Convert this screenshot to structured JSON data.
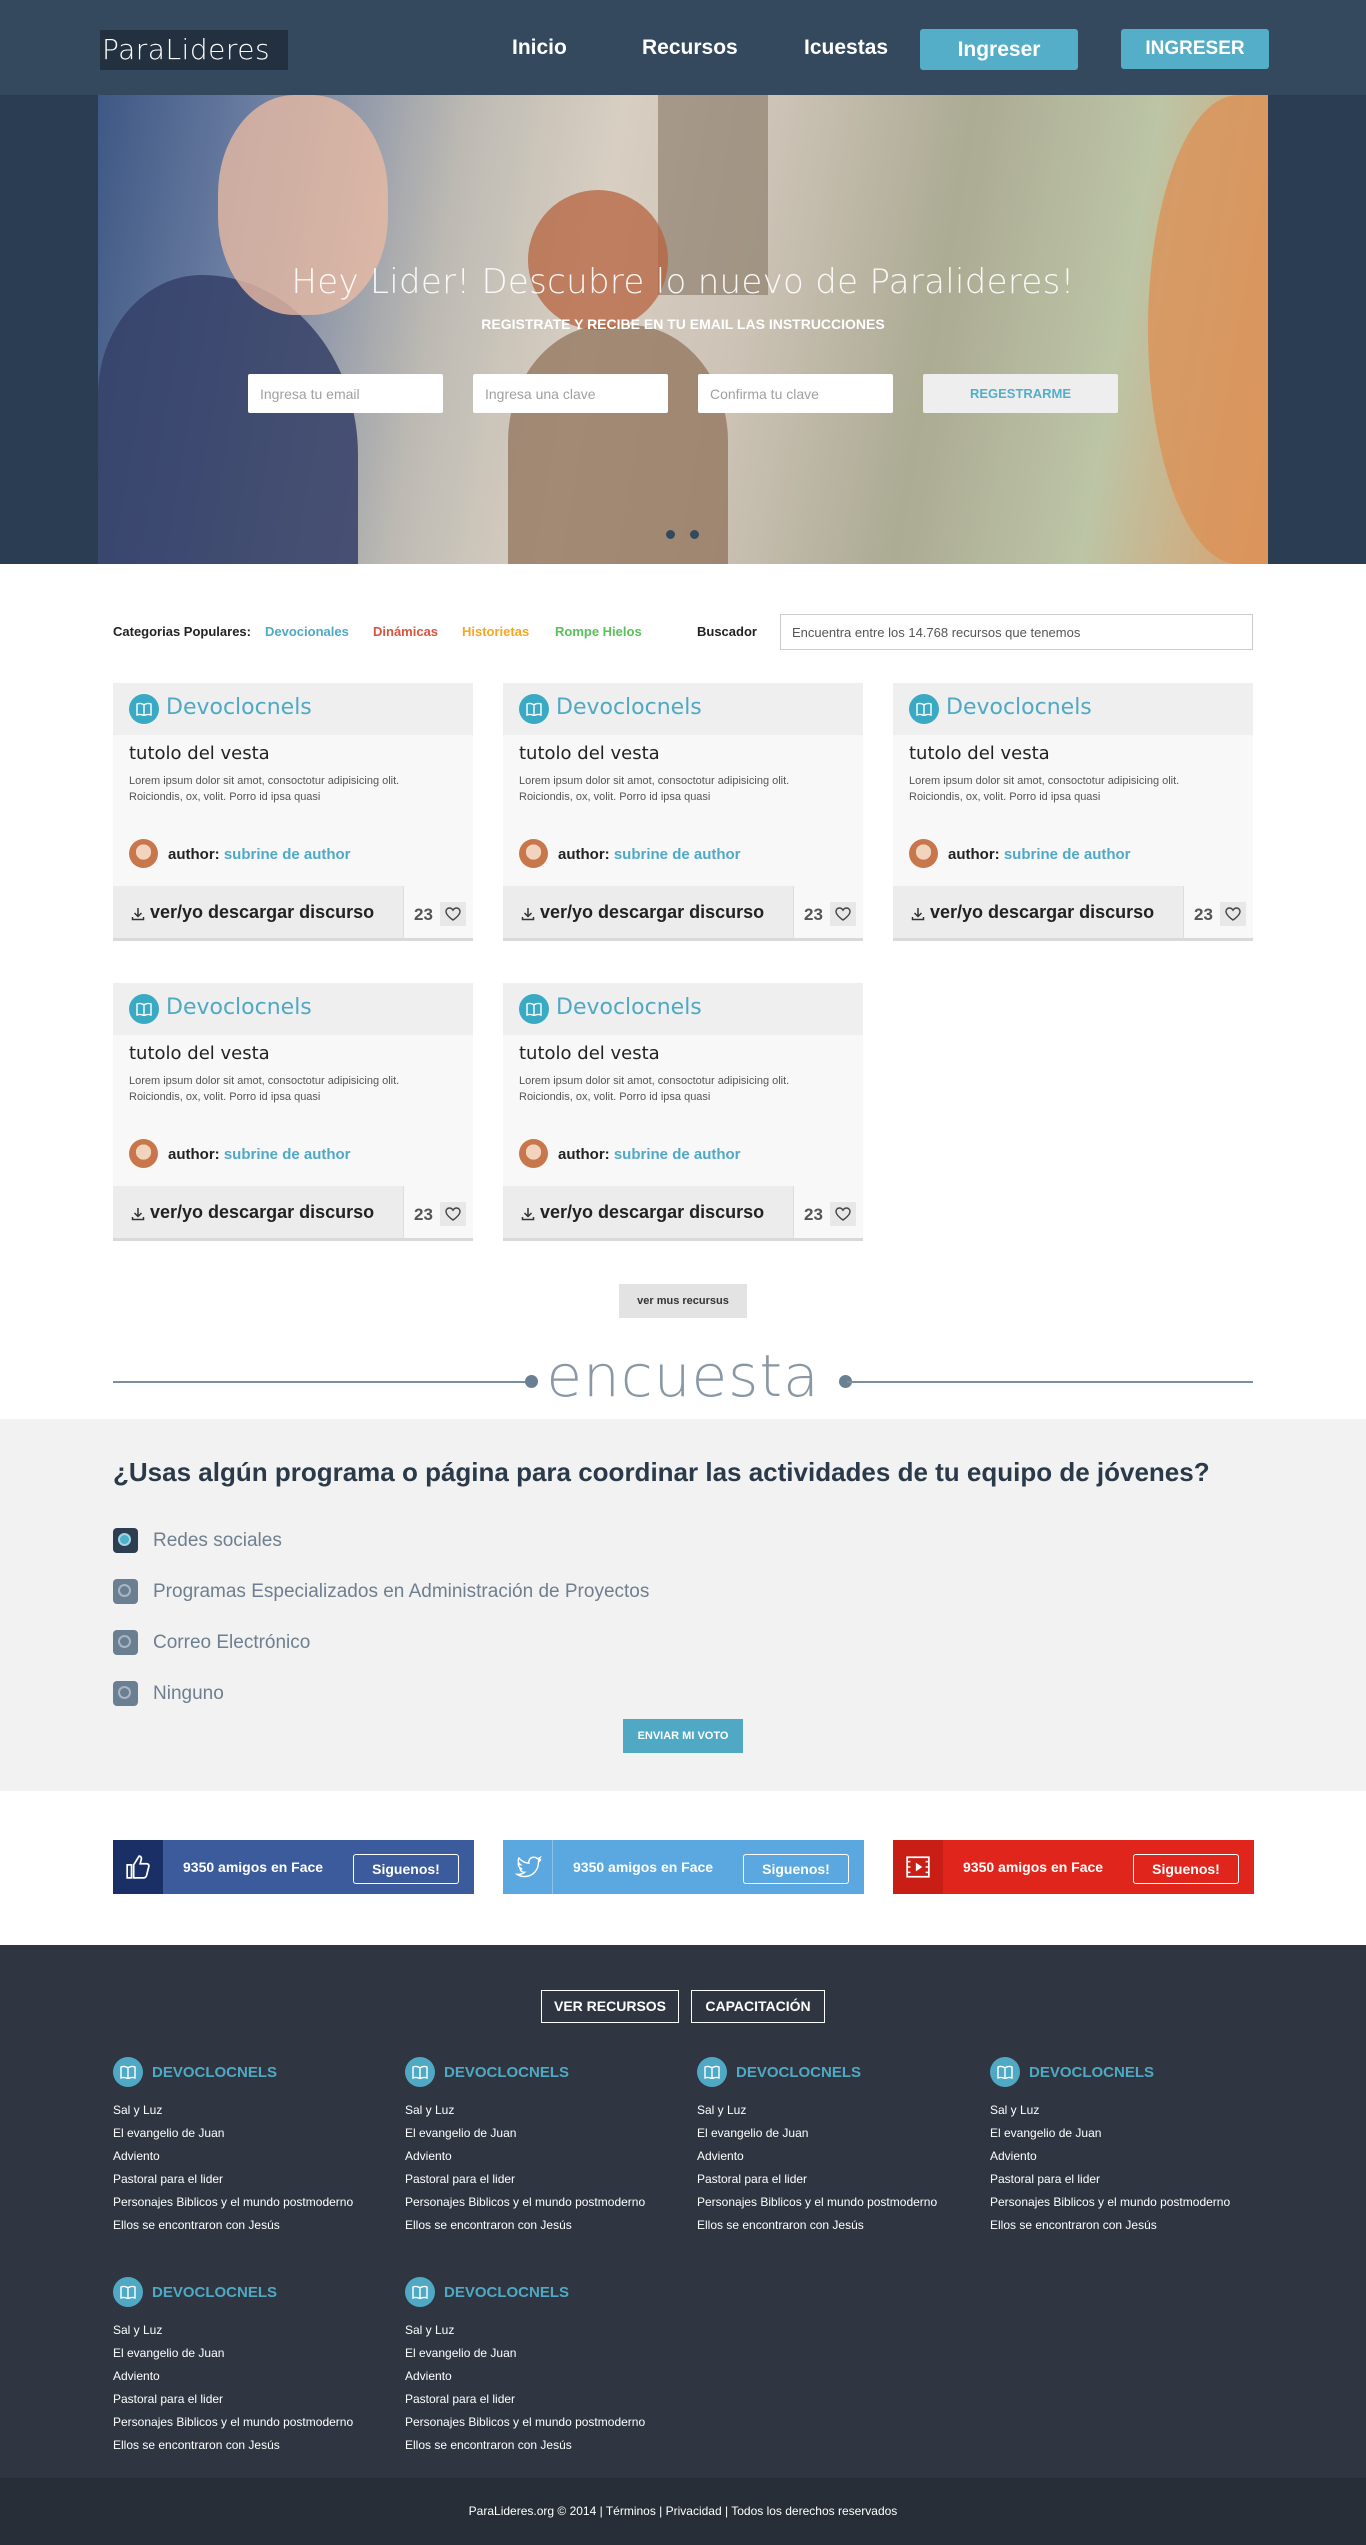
{
  "header": {
    "logo": "ParaLideres",
    "nav": [
      "Inicio",
      "Recursos",
      "Icuestas"
    ],
    "login_button": "Ingreser",
    "login_button_alt": "INGRESER",
    "colors": {
      "bar": "#34495e",
      "accent": "#54aec8"
    }
  },
  "hero": {
    "title": "Hey Lider! Descubre lo nuevo de Paralideres!",
    "subtitle": "REGISTRATE Y RECIBE EN TU EMAIL LAS INSTRUCCIONES",
    "email_placeholder": "Ingresa tu email",
    "password_placeholder": "Ingresa una clave",
    "confirm_placeholder": "Confirma tu clave",
    "register_button": "REGESTRARME",
    "slides": 2
  },
  "categories": {
    "label": "Categorias Populares:",
    "items": [
      {
        "label": "Devocionales",
        "color": "#4fa9c5"
      },
      {
        "label": "Dinámicas",
        "color": "#d9533f"
      },
      {
        "label": "Historietas",
        "color": "#f5a623"
      },
      {
        "label": "Rompe Hielos",
        "color": "#5ac05a"
      }
    ],
    "search_label": "Buscador",
    "search_placeholder": "Encuentra entre los 14.768 recursos que tenemos"
  },
  "resources": [
    {
      "category": "Devoclocnels",
      "title": "tutolo del vesta",
      "description": "Lorem ipsum dolor sit amot, consoctotur adipisicing olit. Roiciondis, ox, volit. Porro id ipsa quasi",
      "author_label": "author:",
      "author": "subrine de author",
      "download_label": "ver/yo descargar discurso",
      "likes": "23"
    },
    {
      "category": "Devoclocnels",
      "title": "tutolo del vesta",
      "description": "Lorem ipsum dolor sit amot, consoctotur adipisicing olit. Roiciondis, ox, volit. Porro id ipsa quasi",
      "author_label": "author:",
      "author": "subrine de author",
      "download_label": "ver/yo descargar discurso",
      "likes": "23"
    },
    {
      "category": "Devoclocnels",
      "title": "tutolo del vesta",
      "description": "Lorem ipsum dolor sit amot, consoctotur adipisicing olit. Roiciondis, ox, volit. Porro id ipsa quasi",
      "author_label": "author:",
      "author": "subrine de author",
      "download_label": "ver/yo descargar discurso",
      "likes": "23"
    },
    {
      "category": "Devoclocnels",
      "title": "tutolo del vesta",
      "description": "Lorem ipsum dolor sit amot, consoctotur adipisicing olit. Roiciondis, ox, volit. Porro id ipsa quasi",
      "author_label": "author:",
      "author": "subrine de author",
      "download_label": "ver/yo descargar discurso",
      "likes": "23"
    },
    {
      "category": "Devoclocnels",
      "title": "tutolo del vesta",
      "description": "Lorem ipsum dolor sit amot, consoctotur adipisicing olit. Roiciondis, ox, volit. Porro id ipsa quasi",
      "author_label": "author:",
      "author": "subrine de author",
      "download_label": "ver/yo descargar discurso",
      "likes": "23"
    }
  ],
  "more_button": "ver mus recursus",
  "poll": {
    "heading": "encuesta",
    "question": "¿Usas algún programa o página para coordinar las actividades de tu equipo de jóvenes?",
    "options": [
      {
        "label": "Redes sociales",
        "selected": true
      },
      {
        "label": "Programas Especializados en Administración de Proyectos",
        "selected": false
      },
      {
        "label": "Correo Electrónico",
        "selected": false
      },
      {
        "label": "Ninguno",
        "selected": false
      }
    ],
    "vote_button": "ENVIAR MI VOTO"
  },
  "social": [
    {
      "network": "facebook",
      "icon": "thumbs-up-icon",
      "text": "9350 amigos en Face",
      "button": "Siguenos!",
      "color": "#3b5b9c",
      "icon_bg": "#1a2f66"
    },
    {
      "network": "twitter",
      "icon": "twitter-bird-icon",
      "text": "9350 amigos en Face",
      "button": "Siguenos!",
      "color": "#5aa8df",
      "icon_bg": "#5aa8df"
    },
    {
      "network": "youtube",
      "icon": "video-icon",
      "text": "9350 amigos en Face",
      "button": "Siguenos!",
      "color": "#e0261c",
      "icon_bg": "#c81e16"
    }
  ],
  "footer": {
    "buttons": [
      "VER RECURSOS",
      "CAPACITACIÓN"
    ],
    "columns": [
      {
        "title": "DEVOCLOCNELS",
        "links": [
          "Sal y Luz",
          "El evangelio de Juan",
          "Adviento",
          "Pastoral para el lider",
          "Personajes Biblicos y el mundo postmoderno",
          "Ellos se encontraron con Jesús"
        ]
      },
      {
        "title": "DEVOCLOCNELS",
        "links": [
          "Sal y Luz",
          "El evangelio de Juan",
          "Adviento",
          "Pastoral para el lider",
          "Personajes Biblicos y el mundo postmoderno",
          "Ellos se encontraron con Jesús"
        ]
      },
      {
        "title": "DEVOCLOCNELS",
        "links": [
          "Sal y Luz",
          "El evangelio de Juan",
          "Adviento",
          "Pastoral para el lider",
          "Personajes Biblicos y el mundo postmoderno",
          "Ellos se encontraron con Jesús"
        ]
      },
      {
        "title": "DEVOCLOCNELS",
        "links": [
          "Sal y Luz",
          "El evangelio de Juan",
          "Adviento",
          "Pastoral para el lider",
          "Personajes Biblicos y el mundo postmoderno",
          "Ellos se encontraron con Jesús"
        ]
      },
      {
        "title": "DEVOCLOCNELS",
        "links": [
          "Sal y Luz",
          "El evangelio de Juan",
          "Adviento",
          "Pastoral para el lider",
          "Personajes Biblicos y el mundo postmoderno",
          "Ellos se encontraron con Jesús"
        ]
      },
      {
        "title": "DEVOCLOCNELS",
        "links": [
          "Sal y Luz",
          "El evangelio de Juan",
          "Adviento",
          "Pastoral para el lider",
          "Personajes Biblicos y el mundo postmoderno",
          "Ellos se encontraron con Jesús"
        ]
      }
    ],
    "copyright": "ParaLideres.org © 2014 | Términos | Privacidad | Todos los derechos reservados"
  }
}
